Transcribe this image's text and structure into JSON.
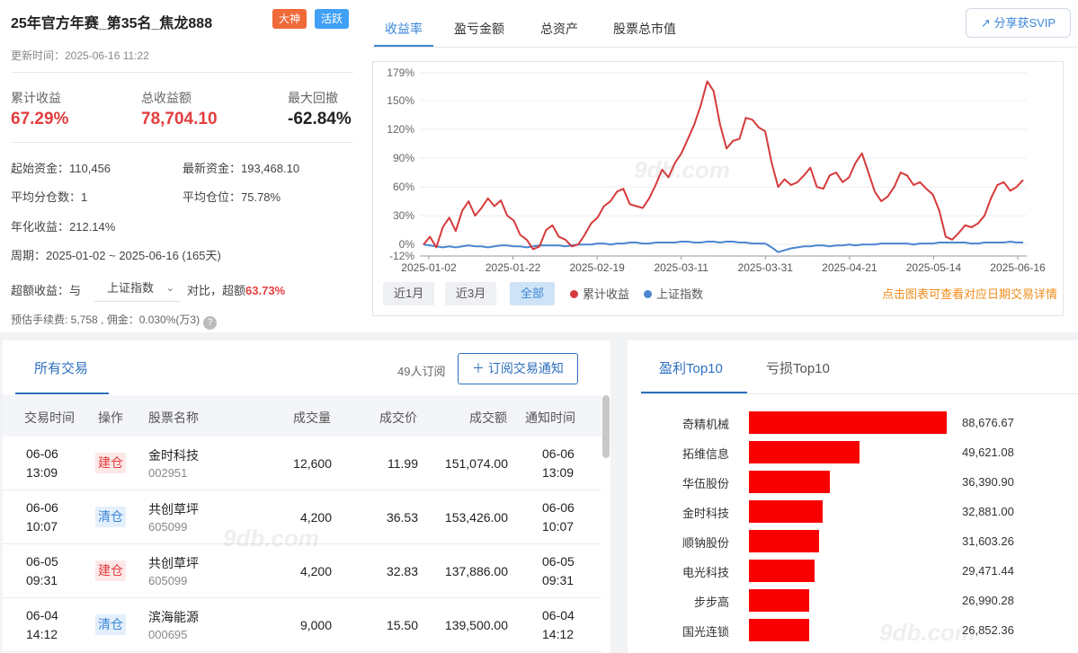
{
  "header": {
    "title": "25年官方年赛_第35名_焦龙888",
    "badge_god": "大神",
    "badge_active": "活跃",
    "updated": "更新时间：2025-06-16 11:22"
  },
  "stats": {
    "cum_return_label": "累计收益",
    "cum_return": "67.29%",
    "total_profit_label": "总收益额",
    "total_profit": "78,704.10",
    "max_dd_label": "最大回撤",
    "max_dd": "-62.84%"
  },
  "info": {
    "start_cap": "起始资金：110,456",
    "latest_cap": "最新资金：193,468.10",
    "avg_parts": "平均分仓数：1",
    "avg_position": "平均仓位：75.78%",
    "annual": "年化收益：212.14%",
    "period": "周期：2025-01-02 ~ 2025-06-16 (165天)",
    "excess_prefix": "超额收益：与",
    "excess_index": "上证指数",
    "excess_mid": "对比，超额",
    "excess_val": "63.73%",
    "fee": "预估手续费: 5,758 , 佣金：0.030%(万3)",
    "help_glyph": "?"
  },
  "tabs": [
    "收益率",
    "盈亏金额",
    "总资产",
    "股票总市值"
  ],
  "share_label": "分享获SVIP",
  "chart_data": {
    "type": "line",
    "title": "",
    "ylabels": [
      "179%",
      "150%",
      "120%",
      "90%",
      "60%",
      "30%",
      "0%",
      "-12%"
    ],
    "xlabels": [
      "2025-01-02",
      "2025-01-22",
      "2025-02-19",
      "2025-03-11",
      "2025-03-31",
      "2025-04-21",
      "2025-05-14",
      "2025-06-16"
    ],
    "ylim": [
      -12,
      179
    ],
    "series": [
      {
        "name": "累计收益",
        "color": "#d63a3a",
        "values": [
          0,
          8,
          -3,
          18,
          28,
          14,
          35,
          45,
          30,
          38,
          48,
          40,
          46,
          30,
          25,
          10,
          5,
          -5,
          -2,
          15,
          20,
          8,
          5,
          -2,
          0,
          10,
          22,
          28,
          40,
          45,
          55,
          58,
          42,
          40,
          38,
          48,
          62,
          78,
          70,
          85,
          95,
          110,
          125,
          145,
          170,
          160,
          125,
          100,
          108,
          110,
          132,
          130,
          122,
          118,
          85,
          60,
          68,
          62,
          65,
          72,
          80,
          60,
          58,
          72,
          75,
          65,
          70,
          85,
          95,
          75,
          55,
          45,
          50,
          60,
          75,
          72,
          62,
          65,
          58,
          52,
          35,
          8,
          5,
          12,
          20,
          18,
          22,
          30,
          48,
          62,
          65,
          56,
          60,
          67.29
        ]
      },
      {
        "name": "上证指数",
        "color": "#4a86d0",
        "values": [
          0,
          -1,
          -2,
          -3,
          -2,
          -3,
          -2,
          -1,
          -2,
          -2,
          -3,
          -2,
          -1,
          -1,
          -2,
          -2,
          -3,
          -2,
          -1,
          -1,
          -1,
          -1,
          -2,
          -1,
          0,
          0,
          0,
          1,
          1,
          0,
          1,
          1,
          2,
          2,
          1,
          1,
          2,
          2,
          2,
          2,
          3,
          3,
          2,
          2,
          3,
          3,
          2,
          3,
          3,
          2,
          2,
          1,
          1,
          1,
          -3,
          -8,
          -6,
          -4,
          -3,
          -2,
          -2,
          -1,
          -1,
          -2,
          -1,
          -1,
          0,
          -1,
          0,
          0,
          0,
          1,
          1,
          1,
          1,
          1,
          0,
          1,
          1,
          1,
          2,
          2,
          2,
          2,
          2,
          1,
          1,
          2,
          2,
          2,
          2,
          3,
          2,
          2
        ]
      }
    ]
  },
  "ranges": [
    "近1月",
    "近3月",
    "全部"
  ],
  "legend": [
    "累计收益",
    "上证指数"
  ],
  "chart_hint": "点击图表可查看对应日期交易详情",
  "trades": {
    "tab": "所有交易",
    "subs": "49人订阅",
    "sub_btn": "＋ 订阅交易通知",
    "columns": [
      "交易时间",
      "操作",
      "股票名称",
      "成交量",
      "成交价",
      "成交额",
      "通知时间"
    ],
    "rows": [
      {
        "date": "06-06",
        "time": "13:09",
        "op": "建仓",
        "name": "金时科技",
        "code": "002951",
        "vol": "12,600",
        "price": "11.99",
        "amount": "151,074.00",
        "ndate": "06-06",
        "ntime": "13:09"
      },
      {
        "date": "06-06",
        "time": "10:07",
        "op": "清仓",
        "name": "共创草坪",
        "code": "605099",
        "vol": "4,200",
        "price": "36.53",
        "amount": "153,426.00",
        "ndate": "06-06",
        "ntime": "10:07"
      },
      {
        "date": "06-05",
        "time": "09:31",
        "op": "建仓",
        "name": "共创草坪",
        "code": "605099",
        "vol": "4,200",
        "price": "32.83",
        "amount": "137,886.00",
        "ndate": "06-05",
        "ntime": "09:31"
      },
      {
        "date": "06-04",
        "time": "14:12",
        "op": "清仓",
        "name": "滨海能源",
        "code": "000695",
        "vol": "9,000",
        "price": "15.50",
        "amount": "139,500.00",
        "ndate": "06-04",
        "ntime": "14:12"
      }
    ]
  },
  "top10": {
    "tab_profit": "盈利Top10",
    "tab_loss": "亏损Top10",
    "items": [
      {
        "name": "奇精机械",
        "value": 88676.67,
        "label": "88,676.67"
      },
      {
        "name": "拓维信息",
        "value": 49621.08,
        "label": "49,621.08"
      },
      {
        "name": "华伍股份",
        "value": 36390.9,
        "label": "36,390.90"
      },
      {
        "name": "金时科技",
        "value": 32881.0,
        "label": "32,881.00"
      },
      {
        "name": "顺钠股份",
        "value": 31603.26,
        "label": "31,603.26"
      },
      {
        "name": "电光科技",
        "value": 29471.44,
        "label": "29,471.44"
      },
      {
        "name": "步步高",
        "value": 26990.28,
        "label": "26,990.28"
      },
      {
        "name": "国光连锁",
        "value": 26852.36,
        "label": "26,852.36"
      }
    ]
  },
  "watermark": "9db.com"
}
